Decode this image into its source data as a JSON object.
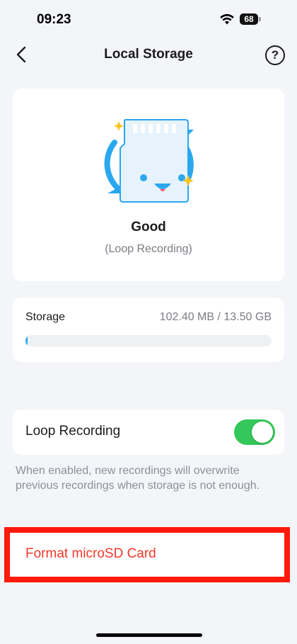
{
  "status_bar": {
    "time": "09:23",
    "battery": "68"
  },
  "header": {
    "title": "Local Storage",
    "back_icon": "chevron-left-icon",
    "help_icon": "question-circle-icon",
    "help_glyph": "?"
  },
  "sd_status": {
    "illustration": "sd-card-loop-icon",
    "health": "Good",
    "mode": "(Loop Recording)"
  },
  "storage": {
    "label": "Storage",
    "value": "102.40 MB / 13.50 GB",
    "used_fraction": 0.0074,
    "bar_color": "#2ba7f0"
  },
  "loop_recording": {
    "label": "Loop Recording",
    "enabled": true,
    "toggle_color": "#34c759",
    "note": "When enabled, new recordings will overwrite previous recordings when storage is not enough."
  },
  "format": {
    "label": "Format microSD Card",
    "label_color": "#f2392b"
  }
}
